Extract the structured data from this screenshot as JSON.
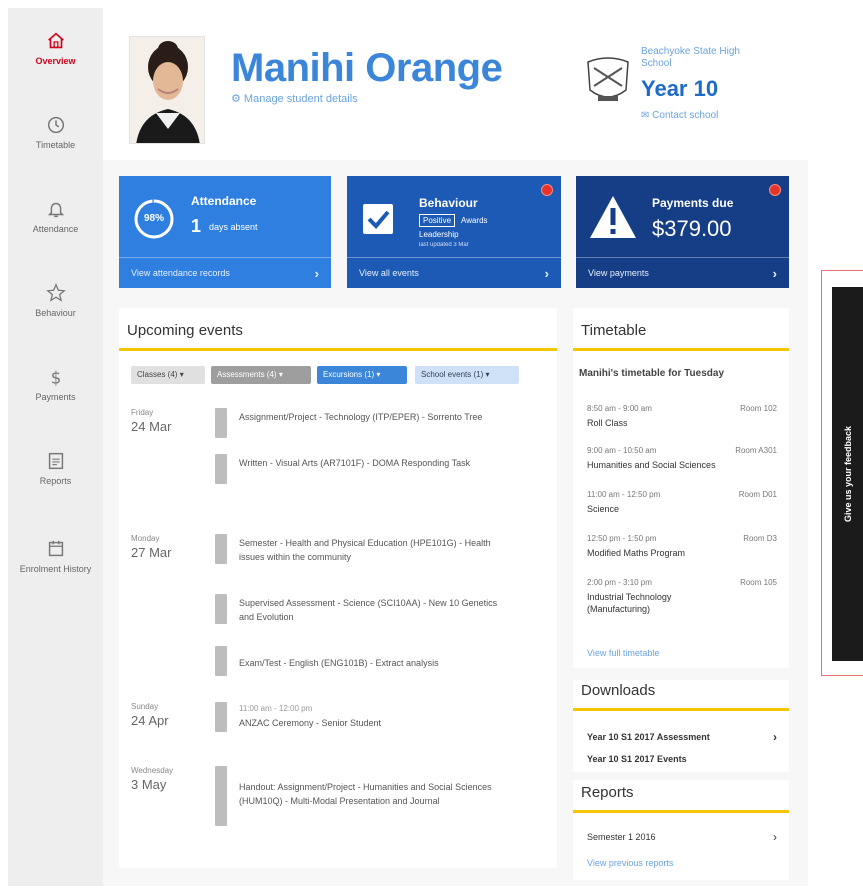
{
  "sidebar": {
    "items": [
      {
        "label": "Overview",
        "icon": "home-icon",
        "active": true
      },
      {
        "label": "Timetable",
        "icon": "clock-icon",
        "active": false
      },
      {
        "label": "Attendance",
        "icon": "bell-icon",
        "active": false
      },
      {
        "label": "Behaviour",
        "icon": "star-icon",
        "active": false
      },
      {
        "label": "Payments",
        "icon": "dollar-icon",
        "active": false
      },
      {
        "label": "Reports",
        "icon": "report-icon",
        "active": false
      },
      {
        "label": "Enrolment History",
        "icon": "calendar-icon",
        "active": false
      }
    ]
  },
  "header": {
    "student_name": "Manihi Orange",
    "student_link": "Manage student details",
    "school_name": "Beachyoke State High School",
    "year": "Year 10",
    "contact_link": "Contact school"
  },
  "cards": {
    "attendance": {
      "title": "Attendance",
      "percent": "98%",
      "count": "1",
      "count_label": "days absent",
      "footer": "View attendance records"
    },
    "behaviour": {
      "title": "Behaviour",
      "positive": "Positive",
      "award": "Awards",
      "line2": "Leadership",
      "line3": "last updated 3 Mar",
      "footer": "View all events"
    },
    "payments": {
      "title": "Payments due",
      "amount": "$379.00",
      "footer": "View payments"
    }
  },
  "events": {
    "title": "Upcoming events",
    "filters": [
      "Classes (4)",
      "Assessments (4)",
      "Excursions (1)",
      "School events (1)"
    ],
    "groups": [
      {
        "dow": "Friday",
        "date": "24 Mar",
        "items": [
          "Assignment/Project - Technology (ITP/EPER) - Sorrento Tree",
          "Written - Visual Arts (AR7101F) - DOMA Responding Task"
        ]
      },
      {
        "dow": "Monday",
        "date": "27 Mar",
        "items": [
          "Semester - Health and Physical Education (HPE101G) - Health issues within the community",
          "Supervised Assessment - Science (SCI10AA) - New 10 Genetics and Evolution",
          "Exam/Test - English (ENG101B) - Extract analysis"
        ]
      },
      {
        "dow": "Sunday",
        "date": "24 Apr",
        "time": "11:00 am - 12:00 pm",
        "items": [
          "ANZAC Ceremony - Senior Student"
        ]
      },
      {
        "dow": "Wednesday",
        "date": "3 May",
        "items": [
          "Handout: Assignment/Project - Humanities and Social Sciences (HUM10Q) - Multi-Modal Presentation and Journal"
        ]
      }
    ]
  },
  "timetable": {
    "title": "Timetable",
    "subtitle": "Manihi's timetable for Tuesday",
    "rows": [
      {
        "time": "8:50 am - 9:00 am",
        "room": "Room 102",
        "subject": "Roll Class"
      },
      {
        "time": "9:00 am - 10:50 am",
        "room": "Room A301",
        "subject": "Humanities and Social Sciences"
      },
      {
        "time": "11:00 am - 12:50 pm",
        "room": "Room D01",
        "subject": "Science"
      },
      {
        "time": "12:50 pm - 1:50 pm",
        "room": "Room D3",
        "subject": "Modified Maths Program"
      },
      {
        "time": "2:00 pm - 3:10 pm",
        "room": "Room 105",
        "subject": "Industrial Technology (Manufacturing)"
      }
    ],
    "link": "View full timetable"
  },
  "downloads": {
    "title": "Downloads",
    "items": [
      "Year 10 S1 2017 Assessment",
      "Year 10 S1 2017 Events"
    ]
  },
  "reports": {
    "title": "Reports",
    "items": [
      "Semester 1 2016"
    ],
    "link": "View previous reports"
  },
  "feedback": {
    "label": "Give us your feedback"
  },
  "colors": {
    "accent_blue": "#3b86d8",
    "active_red": "#d0021b",
    "section_rule": "#f4c600"
  }
}
